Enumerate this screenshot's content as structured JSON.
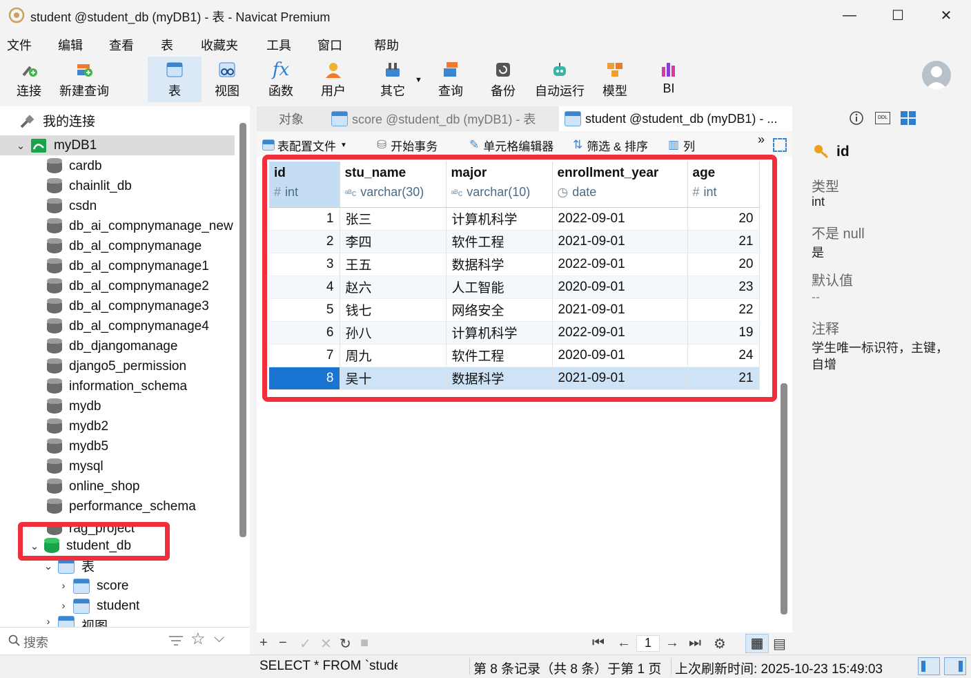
{
  "window": {
    "title": "student @student_db (myDB1) - 表 - Navicat Premium",
    "minimize": "—",
    "maximize": "☐",
    "close": "✕"
  },
  "menu": [
    "文件",
    "编辑",
    "查看",
    "表",
    "收藏夹",
    "工具",
    "窗口",
    "帮助"
  ],
  "toolbar": {
    "items": [
      {
        "label": "连接",
        "icon": "connect-icon"
      },
      {
        "label": "新建查询",
        "icon": "new-query-icon"
      },
      {
        "label": "表",
        "icon": "table-icon",
        "active": true
      },
      {
        "label": "视图",
        "icon": "view-icon"
      },
      {
        "label": "函数",
        "icon": "function-icon"
      },
      {
        "label": "用户",
        "icon": "user-icon"
      },
      {
        "label": "其它",
        "icon": "other-icon"
      },
      {
        "label": "查询",
        "icon": "query-icon"
      },
      {
        "label": "备份",
        "icon": "backup-icon"
      },
      {
        "label": "自动运行",
        "icon": "robot-icon"
      },
      {
        "label": "模型",
        "icon": "model-icon"
      },
      {
        "label": "BI",
        "icon": "bi-icon"
      }
    ]
  },
  "tree": {
    "header": "我的连接",
    "connection": "myDB1",
    "databases": [
      "cardb",
      "chainlit_db",
      "csdn",
      "db_ai_compnymanage_new",
      "db_al_compnymanage",
      "db_al_compnymanage1",
      "db_al_compnymanage2",
      "db_al_compnymanage3",
      "db_al_compnymanage4",
      "db_djangomanage",
      "django5_permission",
      "information_schema",
      "mydb",
      "mydb2",
      "mydb5",
      "mysql",
      "online_shop",
      "performance_schema",
      "rag_project"
    ],
    "open_db": "student_db",
    "tables_node": "表",
    "tables": [
      "score",
      "student"
    ],
    "views_node": "视图",
    "search_placeholder": "搜索"
  },
  "tabs": [
    {
      "label": "对象"
    },
    {
      "label": "score @student_db (myDB1) - 表"
    },
    {
      "label": "student @student_db (myDB1) - ..."
    }
  ],
  "subtoolbar": {
    "config_file": "表配置文件",
    "begin_tx": "开始事务",
    "cell_editor": "单元格编辑器",
    "filter_sort": "筛选 & 排序",
    "columns": "列",
    "more": "»"
  },
  "grid": {
    "columns": [
      {
        "name": "id",
        "type": "int",
        "type_icon": "#"
      },
      {
        "name": "stu_name",
        "type": "varchar(30)",
        "type_icon": "aBc"
      },
      {
        "name": "major",
        "type": "varchar(10)",
        "type_icon": "aBc"
      },
      {
        "name": "enrollment_year",
        "type": "date",
        "type_icon": "clock"
      },
      {
        "name": "age",
        "type": "int",
        "type_icon": "#"
      }
    ],
    "rows": [
      [
        "1",
        "张三",
        "计算机科学",
        "2022-09-01",
        "20"
      ],
      [
        "2",
        "李四",
        "软件工程",
        "2021-09-01",
        "21"
      ],
      [
        "3",
        "王五",
        "数据科学",
        "2022-09-01",
        "20"
      ],
      [
        "4",
        "赵六",
        "人工智能",
        "2020-09-01",
        "23"
      ],
      [
        "5",
        "钱七",
        "网络安全",
        "2021-09-01",
        "22"
      ],
      [
        "6",
        "孙八",
        "计算机科学",
        "2022-09-01",
        "19"
      ],
      [
        "7",
        "周九",
        "软件工程",
        "2020-09-01",
        "24"
      ],
      [
        "8",
        "吴十",
        "数据科学",
        "2021-09-01",
        "21"
      ]
    ],
    "selected_row": 7,
    "page": "1"
  },
  "right": {
    "field": "id",
    "type_label": "类型",
    "type_value": "int",
    "notnull_label": "不是 null",
    "notnull_value": "是",
    "default_label": "默认值",
    "default_value": "--",
    "comment_label": "注释",
    "comment_value_1": "学生唯一标识符，主键，",
    "comment_value_2": "自增"
  },
  "status": {
    "sql": "SELECT * FROM `studer",
    "records": "第 8 条记录（共 8 条）于第 1 页",
    "refresh": "上次刷新时间: 2025-10-23 15:49:03"
  },
  "colors": {
    "accent": "#1a74d1",
    "highlight_box": "#ef2f3c",
    "db_green": "#1aa34a"
  }
}
